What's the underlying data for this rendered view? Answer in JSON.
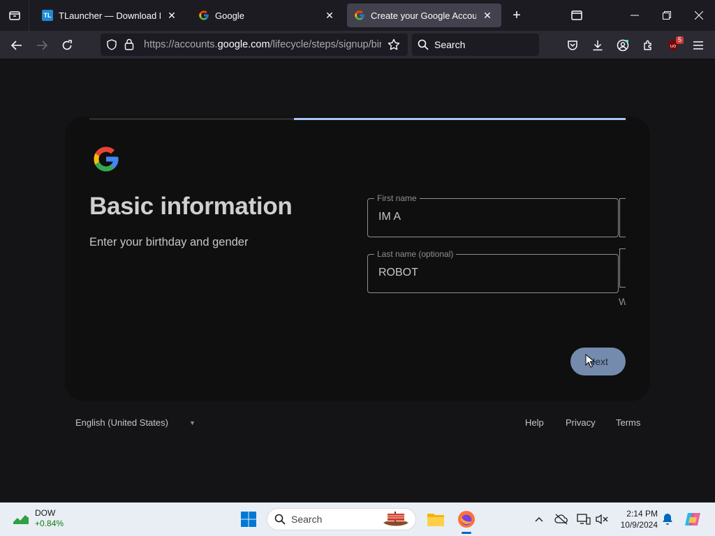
{
  "browser": {
    "tabs": [
      {
        "title": "TLauncher — Download Minecraft",
        "favicon": "TL"
      },
      {
        "title": "Google",
        "favicon": "google"
      },
      {
        "title": "Create your Google Account",
        "favicon": "google",
        "active": true
      }
    ],
    "url": {
      "prefix": "https://accounts.",
      "domain": "google.com",
      "path": "/lifecycle/steps/signup/birthdaygender"
    },
    "search_placeholder": "Search",
    "extension_badge": "5"
  },
  "page": {
    "heading": "Basic information",
    "subheading": "Enter your birthday and gender",
    "first_name": {
      "label": "First name",
      "value": "IM A"
    },
    "last_name": {
      "label": "Last name (optional)",
      "value": "ROBOT"
    },
    "clipped_text": "W",
    "next_label": "Next",
    "progress_fraction": 0.62,
    "footer": {
      "language": "English (United States)",
      "links": [
        "Help",
        "Privacy",
        "Terms"
      ]
    }
  },
  "taskbar": {
    "stock": {
      "name": "DOW",
      "change": "+0.84%"
    },
    "search_placeholder": "Search",
    "time": "2:14 PM",
    "date": "10/9/2024"
  },
  "colors": {
    "accent": "#a8c7fa",
    "button": "#748bae",
    "card": "#0f0f10"
  }
}
